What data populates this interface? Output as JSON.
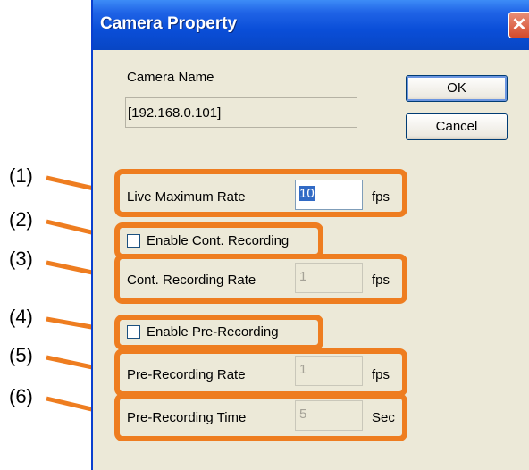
{
  "dialog": {
    "title": "Camera Property",
    "close_label": "✕",
    "camera_name_label": "Camera Name",
    "camera_name_value": "[192.168.0.101]",
    "ok_label": "OK",
    "cancel_label": "Cancel"
  },
  "settings": [
    {
      "callout": "(1)",
      "label": "Live Maximum Rate",
      "value": "10",
      "unit": "fps"
    },
    {
      "callout": "(2)",
      "label": "Enable Cont. Recording",
      "checked": false
    },
    {
      "callout": "(3)",
      "label": "Cont. Recording Rate",
      "value": "1",
      "unit": "fps"
    },
    {
      "callout": "(4)",
      "label": "Enable Pre-Recording",
      "checked": false
    },
    {
      "callout": "(5)",
      "label": "Pre-Recording Rate",
      "value": "1",
      "unit": "fps"
    },
    {
      "callout": "(6)",
      "label": "Pre-Recording Time",
      "value": "5",
      "unit": "Sec"
    }
  ],
  "colors": {
    "callout_orange": "#ee7d20",
    "titlebar_blue": "#0a4ed8"
  }
}
